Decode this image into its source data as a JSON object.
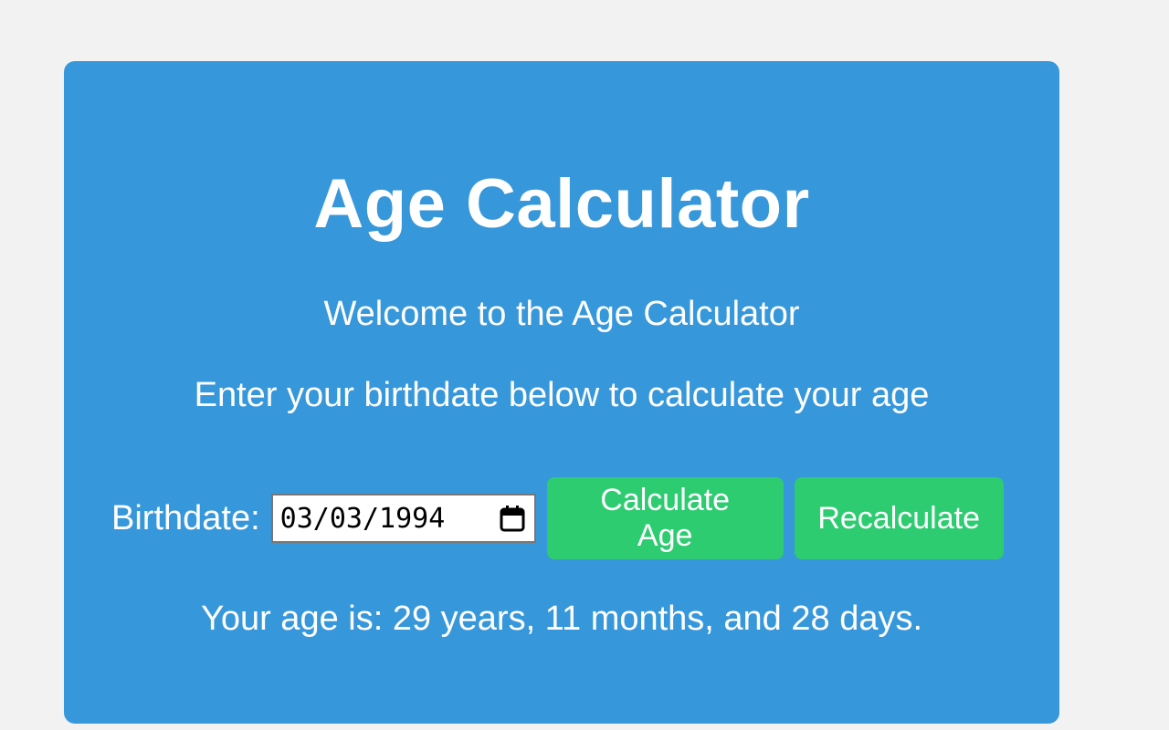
{
  "app": {
    "title": "Age Calculator",
    "welcome": "Welcome to the Age Calculator",
    "instructions": "Enter your birthdate below to calculate your age"
  },
  "form": {
    "birthdate_label": "Birthdate:",
    "birthdate_value": "03/03/1994",
    "calculate_label": "Calculate Age",
    "recalculate_label": "Recalculate"
  },
  "result": {
    "text": "Your age is: 29 years, 11 months, and 28 days."
  },
  "icons": {
    "date_picker": "calendar-icon"
  },
  "colors": {
    "page_background": "#f2f2f2",
    "card_background": "#3797db",
    "button_background": "#2ecc71",
    "text": "#ffffff"
  }
}
